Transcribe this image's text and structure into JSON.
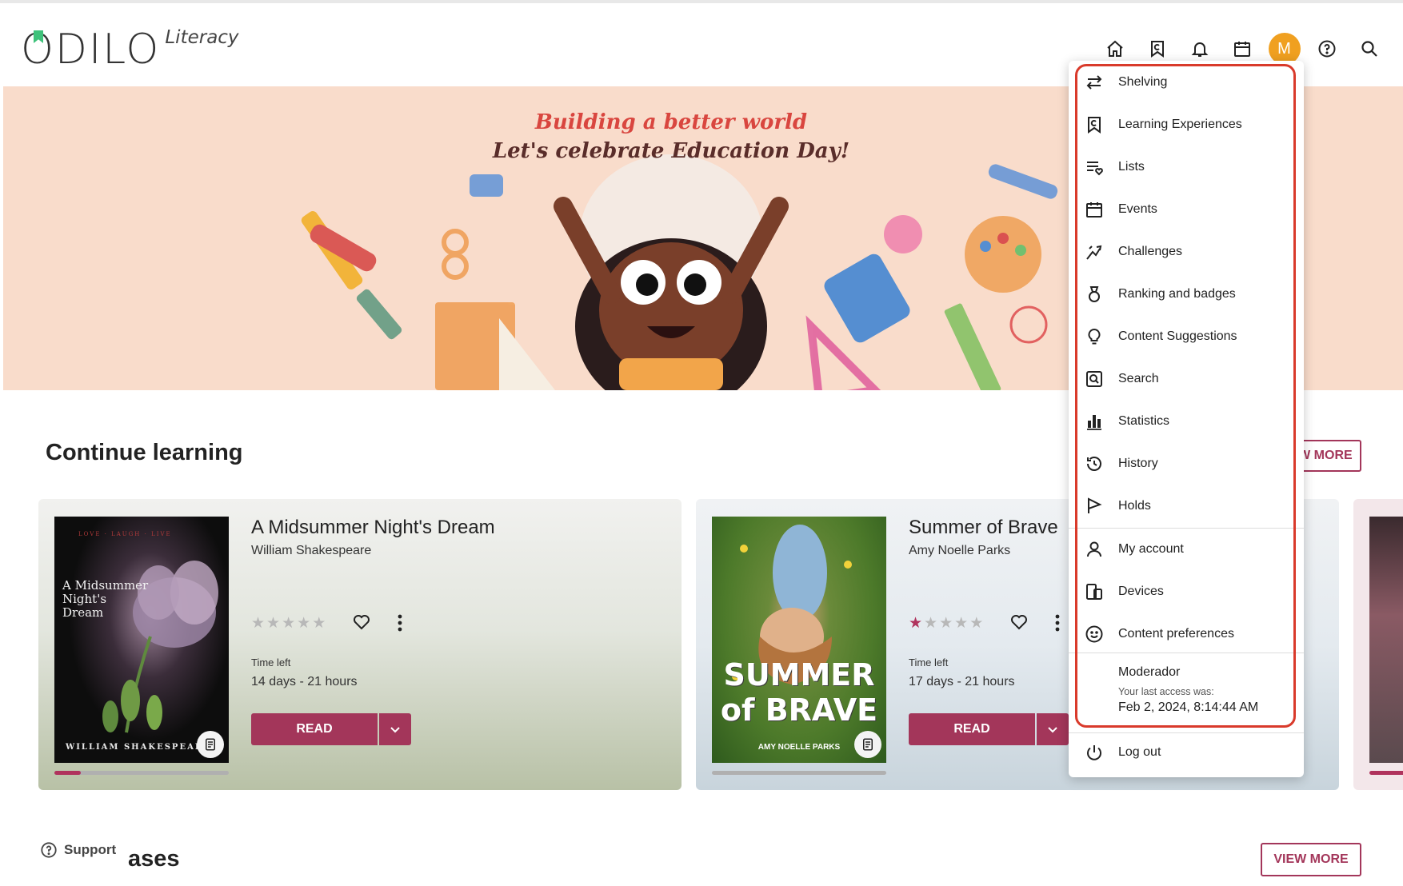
{
  "logo": {
    "word": "ODILO",
    "sub": "Literacy"
  },
  "header": {
    "nav": [
      {
        "name": "home-icon"
      },
      {
        "name": "learning-experiences-icon"
      },
      {
        "name": "bell-icon"
      },
      {
        "name": "calendar-icon"
      },
      {
        "name": "avatar"
      },
      {
        "name": "help-icon"
      },
      {
        "name": "search-icon"
      }
    ],
    "avatar_initial": "M"
  },
  "banner": {
    "line1": "Building a better world",
    "line2": "Let's celebrate Education Day!"
  },
  "continue_learning": {
    "title": "Continue learning",
    "view_more": "VIEW MORE",
    "cards": [
      {
        "title": "A Midsummer Night's Dream",
        "author": "William Shakespeare",
        "cover_top": "LOVE · LAUGH · LIVE",
        "cover_title": "A Midsummer Night's Dream",
        "cover_author": "WILLIAM SHAKESPEARE",
        "rating": 0,
        "time_label": "Time left",
        "time_value": "14 days - 21 hours",
        "read_label": "READ",
        "progress": 0.15
      },
      {
        "title": "Summer of Brave",
        "author": "Amy Noelle Parks",
        "cover_title": "SUMMER of BRAVE",
        "cover_author": "AMY NOELLE PARKS",
        "rating": 1,
        "time_label": "Time left",
        "time_value": "17 days - 21 hours",
        "read_label": "READ",
        "progress": 0.0
      }
    ]
  },
  "releases": {
    "title": "ases",
    "view_more": "VIEW MORE"
  },
  "support": {
    "label": "Support"
  },
  "menu": {
    "items": [
      {
        "label": "Shelving",
        "icon": "swap-icon"
      },
      {
        "label": "Learning Experiences",
        "icon": "learning-experiences-icon"
      },
      {
        "label": "Lists",
        "icon": "list-heart-icon"
      },
      {
        "label": "Events",
        "icon": "calendar-icon"
      },
      {
        "label": "Challenges",
        "icon": "challenge-icon"
      },
      {
        "label": "Ranking and badges",
        "icon": "medal-icon"
      },
      {
        "label": "Content Suggestions",
        "icon": "lightbulb-icon"
      },
      {
        "label": "Search",
        "icon": "search-box-icon"
      },
      {
        "label": "Statistics",
        "icon": "bar-chart-icon"
      },
      {
        "label": "History",
        "icon": "history-icon"
      },
      {
        "label": "Holds",
        "icon": "flag-icon"
      }
    ],
    "account_items": [
      {
        "label": "My account",
        "icon": "person-icon"
      },
      {
        "label": "Devices",
        "icon": "devices-icon"
      },
      {
        "label": "Content preferences",
        "icon": "smiley-icon"
      }
    ],
    "user": {
      "role": "Moderador",
      "last_access_label": "Your last access was:",
      "last_access_date": "Feb 2, 2024, 8:14:44 AM"
    },
    "logout": {
      "label": "Log out",
      "icon": "power-icon"
    }
  },
  "colors": {
    "accent": "#a3365a",
    "avatar": "#f0a020",
    "highlight": "#d93a2b"
  }
}
